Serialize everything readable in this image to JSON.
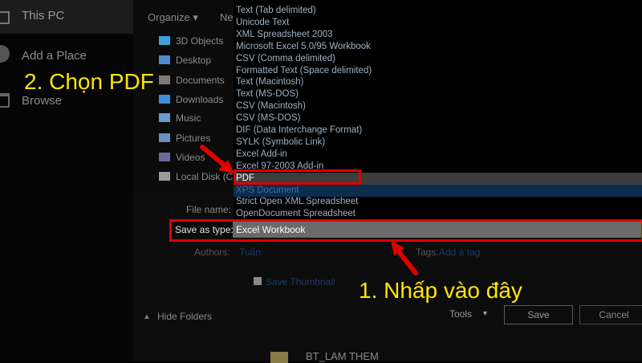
{
  "backstage": {
    "this_pc": "This PC",
    "add_place": "Add a Place",
    "browse": "Browse"
  },
  "toolbar": {
    "organize": "Organize ▾",
    "new_folder": "Ne"
  },
  "nav": [
    {
      "label": "3D Objects",
      "icon": "cube-icon",
      "color": "#3fa0d8"
    },
    {
      "label": "Desktop",
      "icon": "desktop-icon",
      "color": "#4b8bd0"
    },
    {
      "label": "Documents",
      "icon": "documents-icon",
      "color": "#7a7a7a"
    },
    {
      "label": "Downloads",
      "icon": "download-arrow-icon",
      "color": "#3c8fd8"
    },
    {
      "label": "Music",
      "icon": "music-note-icon",
      "color": "#6a9ad0"
    },
    {
      "label": "Pictures",
      "icon": "pictures-icon",
      "color": "#6a90c0"
    },
    {
      "label": "Videos",
      "icon": "videos-icon",
      "color": "#6a6a9a"
    },
    {
      "label": "Local Disk (C:)",
      "icon": "disk-icon",
      "color": "#9a9a9a"
    }
  ],
  "file_types": [
    {
      "label": "Text (Tab delimited)"
    },
    {
      "label": "Unicode Text"
    },
    {
      "label": "XML Spreadsheet 2003"
    },
    {
      "label": "Microsoft Excel 5.0/95 Workbook"
    },
    {
      "label": "CSV (Comma delimited)"
    },
    {
      "label": "Formatted Text (Space delimited)"
    },
    {
      "label": "Text (Macintosh)"
    },
    {
      "label": "Text (MS-DOS)"
    },
    {
      "label": "CSV (Macintosh)"
    },
    {
      "label": "CSV (MS-DOS)"
    },
    {
      "label": "DIF (Data Interchange Format)"
    },
    {
      "label": "SYLK (Symbolic Link)"
    },
    {
      "label": "Excel Add-in"
    },
    {
      "label": "Excel 97-2003 Add-in"
    },
    {
      "label": "PDF",
      "state": "hovered"
    },
    {
      "label": "XPS Document",
      "state": "selected"
    },
    {
      "label": "Strict Open XML Spreadsheet"
    },
    {
      "label": "OpenDocument Spreadsheet"
    }
  ],
  "form": {
    "file_name_label": "File name:",
    "save_as_type_label": "Save as type:",
    "save_as_type_value": "Excel Workbook",
    "authors_label": "Authors:",
    "authors_value": "Tuấn",
    "tags_label": "Tags:",
    "tags_value": "Add a tag",
    "thumbnail_label": "Save Thumbnail",
    "hide_folders": "Hide Folders",
    "tools": "Tools",
    "save": "Save",
    "cancel": "Cancel"
  },
  "folder_row": {
    "label": "BT_LAM THEM"
  },
  "annotations": {
    "step2": "2. Chọn PDF",
    "step1": "1. Nhấp vào đây"
  },
  "colors": {
    "highlight_red": "#e00000",
    "annotation_yellow": "#ffe600",
    "selected_blue": "#0c2d4d"
  }
}
